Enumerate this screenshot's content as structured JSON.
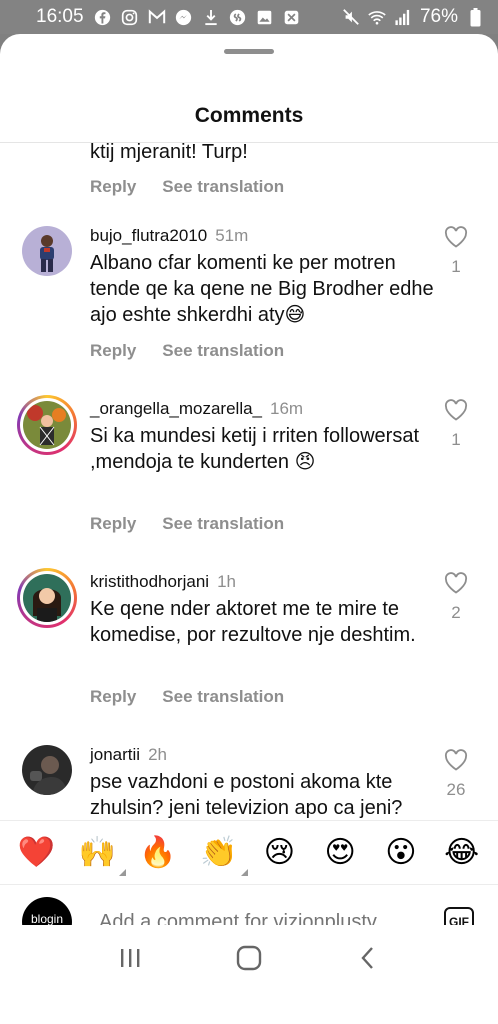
{
  "status_bar": {
    "time": "16:05",
    "battery": "76%",
    "left_icons": [
      "facebook-icon",
      "instagram-icon",
      "gmail-icon",
      "messenger-icon",
      "download-icon",
      "shazam-icon",
      "gallery-icon",
      "x-icon"
    ],
    "right_icons": [
      "mute-icon",
      "wifi-icon",
      "signal-icon",
      "battery-icon"
    ]
  },
  "sheet": {
    "title": "Comments"
  },
  "comments": [
    {
      "username": "",
      "time": "",
      "text": "ktij mjeranit! Turp!",
      "reply": "Reply",
      "translate": "See translation",
      "likes": ""
    },
    {
      "username": "bujo_flutra2010",
      "time": "51m",
      "text": "Albano cfar komenti ke per motren tende qe ka qene ne Big Brodher edhe ajo eshte shkerdhi aty😅",
      "reply": "Reply",
      "translate": "See translation",
      "likes": "1"
    },
    {
      "username": "_orangella_mozarella_",
      "time": "16m",
      "text": "Si ka mundesi ketij i rriten followersat ,mendoja te kunderten 😠",
      "reply": "Reply",
      "translate": "See translation",
      "likes": "1"
    },
    {
      "username": "kristithodhorjani",
      "time": "1h",
      "text": "Ke qene nder aktoret me te mire te komedise, por rezultove nje deshtim.",
      "reply": "Reply",
      "translate": "See translation",
      "likes": "2"
    },
    {
      "username": "jonartii",
      "time": "2h",
      "text": "pse vazhdoni e postoni akoma kte zhulsin? jeni televizion apo ca jeni?",
      "reply": "Reply",
      "translate": "See translation",
      "likes": "26"
    }
  ],
  "emoji_bar": [
    "❤️",
    "🙌",
    "🔥",
    "👏",
    "😢",
    "😍",
    "😮",
    "😂"
  ],
  "input": {
    "placeholder": "Add a comment for vizionplustv...",
    "avatar_text": "blogin",
    "gif_label": "GIF"
  }
}
